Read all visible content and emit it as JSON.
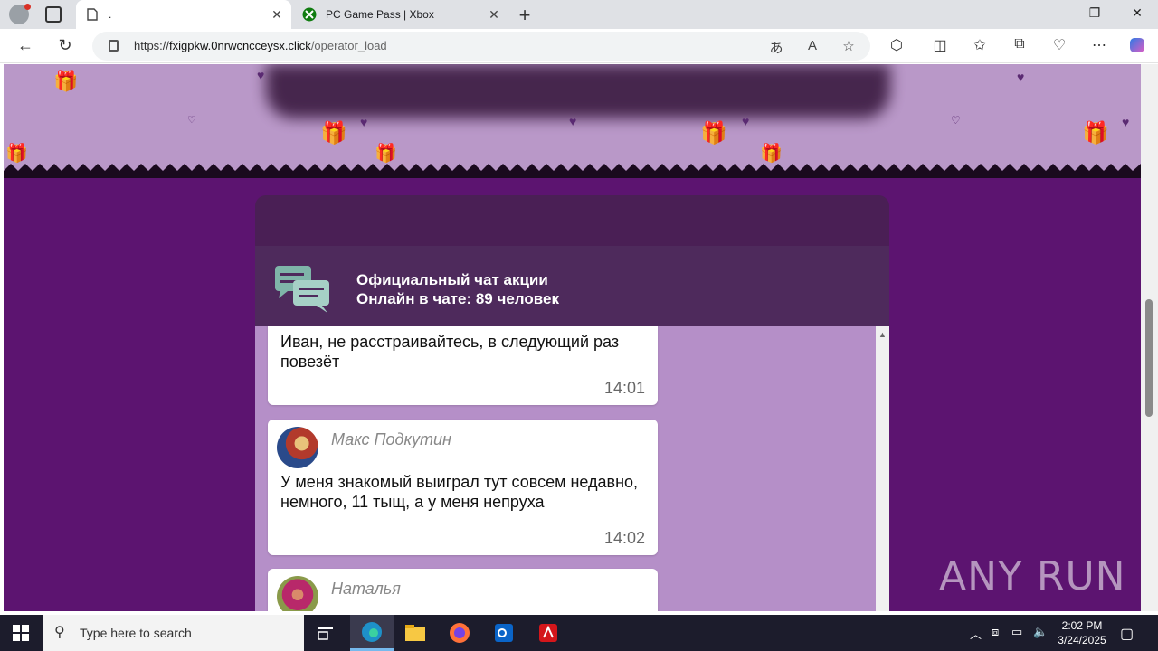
{
  "browser": {
    "tabs": [
      {
        "title": ".",
        "active": true
      },
      {
        "title": "PC Game Pass | Xbox",
        "active": false
      }
    ],
    "address": {
      "scheme": "https://",
      "host": "fxigpkw.0nrwcncceysx.click",
      "path": "/operator_load"
    }
  },
  "chat": {
    "title": "Официальный чат акции",
    "online_label": "Онлайн в чате:  89 человек",
    "messages": [
      {
        "author": "",
        "text": "Иван, не расстраивайтесь, в следующий раз повезёт",
        "time": "14:01"
      },
      {
        "author": "Макс Подкутин",
        "text": "У меня знакомый выиграл тут совсем недавно, немного, 11 тыщ, а у меня непруха",
        "time": "14:02"
      },
      {
        "author": "Наталья",
        "text": "",
        "time": ""
      }
    ]
  },
  "watermark": "ANY RUN",
  "taskbar": {
    "search_placeholder": "Type here to search",
    "time": "2:02 PM",
    "date": "3/24/2025"
  },
  "colors": {
    "page_bg": "#5c1470",
    "banner": "#b998c8",
    "chat_header": "#4e2a5c",
    "chat_body": "#b58fc8"
  }
}
